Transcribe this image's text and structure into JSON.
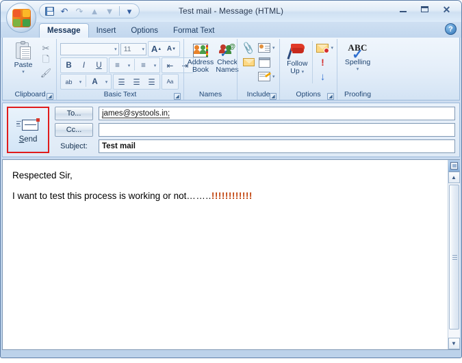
{
  "window": {
    "title": "Test mail  - Message (HTML)",
    "minimize_label": "Minimize",
    "maximize_label": "Maximize",
    "close_label": "Close"
  },
  "quick_access": {
    "office_button": "Office Button",
    "items": [
      {
        "name": "save",
        "label": "Save",
        "glyph": ""
      },
      {
        "name": "undo",
        "label": "Undo",
        "glyph": "↶"
      },
      {
        "name": "redo",
        "label": "Redo",
        "glyph": "↷"
      },
      {
        "name": "previous-item",
        "label": "Previous Item",
        "glyph": "▲"
      },
      {
        "name": "next-item",
        "label": "Next Item",
        "glyph": "▼"
      },
      {
        "name": "customize",
        "label": "Customize Quick Access Toolbar",
        "glyph": "▾"
      }
    ]
  },
  "tabs": [
    {
      "label": "Message",
      "active": true
    },
    {
      "label": "Insert",
      "active": false
    },
    {
      "label": "Options",
      "active": false
    },
    {
      "label": "Format Text",
      "active": false
    }
  ],
  "help": {
    "label": "?"
  },
  "ribbon": {
    "groups": [
      {
        "name": "clipboard",
        "label": "Clipboard",
        "paste_label": "Paste",
        "paste_caret": "▾",
        "cut_label": "Cut",
        "cut_glyph": "✂",
        "copy_label": "Copy",
        "format_painter_label": "Format Painter",
        "dialog_launcher": "⤵"
      },
      {
        "name": "basic-text",
        "label": "Basic Text",
        "font_name": "",
        "font_size": "11",
        "grow_font": "A",
        "shrink_font": "A",
        "bold": "B",
        "italic": "I",
        "underline": "U",
        "bullets": "☰",
        "numbering": "☰",
        "decrease_indent": "⇤",
        "increase_indent": "⇥",
        "highlight": "ab",
        "font_color": "A",
        "align_left": "≡",
        "align_center": "≡",
        "align_right": "≡",
        "clear_formatting": "Aa",
        "caret": "▾",
        "dialog_launcher": "⤵"
      },
      {
        "name": "names",
        "label": "Names",
        "address_book_line1": "Address",
        "address_book_line2": "Book",
        "check_names_line1": "Check",
        "check_names_line2": "Names"
      },
      {
        "name": "include",
        "label": "Include",
        "attach_file": "Attach File",
        "business_card": "Business Card",
        "attach_item": "Attach Item",
        "calendar": "Calendar",
        "signature": "Signature",
        "caret": "▾",
        "dialog_launcher": "⤵"
      },
      {
        "name": "options",
        "label": "Options",
        "follow_up_line1": "Follow",
        "follow_up_line2": "Up",
        "caret": "▾",
        "permission": "Permission",
        "high_importance": "!",
        "low_importance": "↓",
        "dialog_launcher": "⤵"
      },
      {
        "name": "proofing",
        "label": "Proofing",
        "spelling_abc": "ABC",
        "spelling_label": "Spelling",
        "caret": "▾"
      }
    ]
  },
  "compose": {
    "send_label_prefix": "S",
    "send_label_rest": "end",
    "to_button": "To...",
    "to_button_accel": "o",
    "cc_button": "Cc...",
    "subject_label": "Subject:",
    "to_value": "james@systools.in;",
    "cc_value": "",
    "subject_value": "Test mail",
    "send_highlight_color": "#e01b1b"
  },
  "body": {
    "paragraph_1": "Respected Sir,",
    "paragraph_2_text": "I want to test this process is working or not",
    "paragraph_2_dots": "……..",
    "paragraph_2_bangs": "!!!!!!!!!!!!"
  },
  "scrollbar": {
    "select_browse_object": "Select Browse Object",
    "up_arrow": "▲",
    "down_arrow": "▼"
  }
}
